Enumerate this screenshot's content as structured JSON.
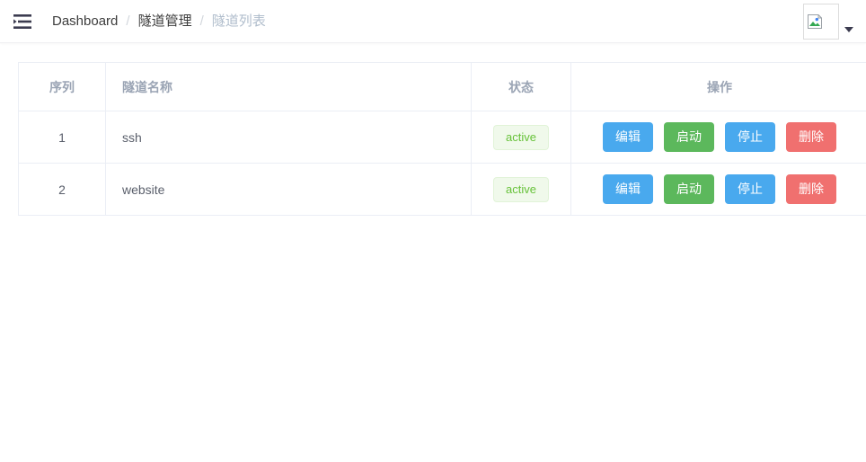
{
  "header": {
    "menu_toggle_icon": "menu-fold-icon",
    "breadcrumb": {
      "items": [
        {
          "label": "Dashboard",
          "active": false
        },
        {
          "label": "隧道管理",
          "active": false
        },
        {
          "label": "隧道列表",
          "active": true
        }
      ],
      "separator": "/"
    },
    "user": {
      "avatar_icon": "broken-image-icon",
      "dropdown_icon": "caret-down-icon"
    }
  },
  "table": {
    "columns": [
      {
        "key": "index",
        "label": "序列"
      },
      {
        "key": "name",
        "label": "隧道名称"
      },
      {
        "key": "status",
        "label": "状态"
      },
      {
        "key": "actions",
        "label": "操作"
      }
    ],
    "rows": [
      {
        "index": "1",
        "name": "ssh",
        "status": "active",
        "actions": [
          {
            "label": "编辑",
            "style": "edit"
          },
          {
            "label": "启动",
            "style": "start"
          },
          {
            "label": "停止",
            "style": "stop"
          },
          {
            "label": "删除",
            "style": "delete"
          }
        ]
      },
      {
        "index": "2",
        "name": "website",
        "status": "active",
        "actions": [
          {
            "label": "编辑",
            "style": "edit"
          },
          {
            "label": "启动",
            "style": "start"
          },
          {
            "label": "停止",
            "style": "stop"
          },
          {
            "label": "删除",
            "style": "delete"
          }
        ]
      }
    ]
  },
  "colors": {
    "btn_edit": "#49a9ee",
    "btn_start": "#5cb85c",
    "btn_stop": "#49a9ee",
    "btn_delete": "#f0706f",
    "badge_bg": "#f0f9eb",
    "badge_text": "#67c23a",
    "header_text": "#9aa4b4",
    "breadcrumb_active": "#b0bdcc",
    "table_border": "#ebeef5"
  }
}
